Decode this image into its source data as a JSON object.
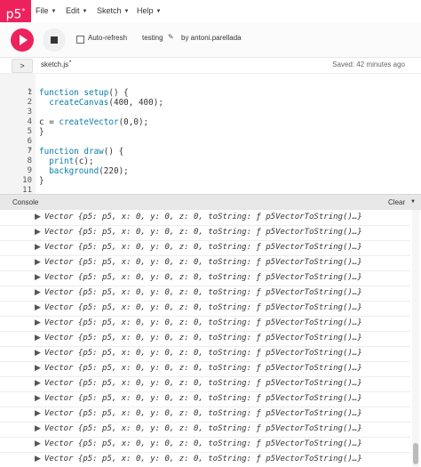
{
  "menubar": {
    "logo": "p5",
    "logo_sup": "*",
    "menus": [
      "File",
      "Edit",
      "Sketch",
      "Help"
    ]
  },
  "toolbar": {
    "autorefresh_label": "Auto-refresh",
    "autorefresh_checked": false,
    "sketch_name": "testing",
    "byline": "by antoni.parellada"
  },
  "filebar": {
    "toggle": ">",
    "filename": "sketch.js",
    "unsaved_marker": "•",
    "saved_status": "Saved: 42 minutes ago"
  },
  "editor": {
    "line_numbers": [
      "1",
      "2",
      "3",
      "4",
      "5",
      "6",
      "7",
      "8",
      "9",
      "10",
      "11"
    ],
    "lines": [
      "function setup() {",
      "  createCanvas(400, 400);",
      "",
      "c = createVector(0,0);",
      "}",
      "",
      "function draw() {",
      "  print(c);",
      "  background(220);",
      "}",
      ""
    ]
  },
  "console": {
    "title": "Console",
    "clear_label": "Clear",
    "entries": [
      "Vector {p5: p5, x: 0, y: 0, z: 0, toString: ƒ p5VectorToString()…}",
      "Vector {p5: p5, x: 0, y: 0, z: 0, toString: ƒ p5VectorToString()…}",
      "Vector {p5: p5, x: 0, y: 0, z: 0, toString: ƒ p5VectorToString()…}",
      "Vector {p5: p5, x: 0, y: 0, z: 0, toString: ƒ p5VectorToString()…}",
      "Vector {p5: p5, x: 0, y: 0, z: 0, toString: ƒ p5VectorToString()…}",
      "Vector {p5: p5, x: 0, y: 0, z: 0, toString: ƒ p5VectorToString()…}",
      "Vector {p5: p5, x: 0, y: 0, z: 0, toString: ƒ p5VectorToString()…}",
      "Vector {p5: p5, x: 0, y: 0, z: 0, toString: ƒ p5VectorToString()…}",
      "Vector {p5: p5, x: 0, y: 0, z: 0, toString: ƒ p5VectorToString()…}",
      "Vector {p5: p5, x: 0, y: 0, z: 0, toString: ƒ p5VectorToString()…}",
      "Vector {p5: p5, x: 0, y: 0, z: 0, toString: ƒ p5VectorToString()…}",
      "Vector {p5: p5, x: 0, y: 0, z: 0, toString: ƒ p5VectorToString()…}",
      "Vector {p5: p5, x: 0, y: 0, z: 0, toString: ƒ p5VectorToString()…}",
      "Vector {p5: p5, x: 0, y: 0, z: 0, toString: ƒ p5VectorToString()…}",
      "Vector {p5: p5, x: 0, y: 0, z: 0, toString: ƒ p5VectorToString()…}",
      "Vector {p5: p5, x: 0, y: 0, z: 0, toString: ƒ p5VectorToString()…}",
      "Vector {p5: p5, x: 0, y: 0, z: 0, toString: ƒ p5VectorToString()…}"
    ]
  },
  "colors": {
    "brand": "#ed225d",
    "keyword": "#0b7ca9"
  },
  "icons": [
    "play-icon",
    "stop-icon",
    "pencil-icon",
    "caret-down-icon",
    "expand-arrow-icon"
  ]
}
